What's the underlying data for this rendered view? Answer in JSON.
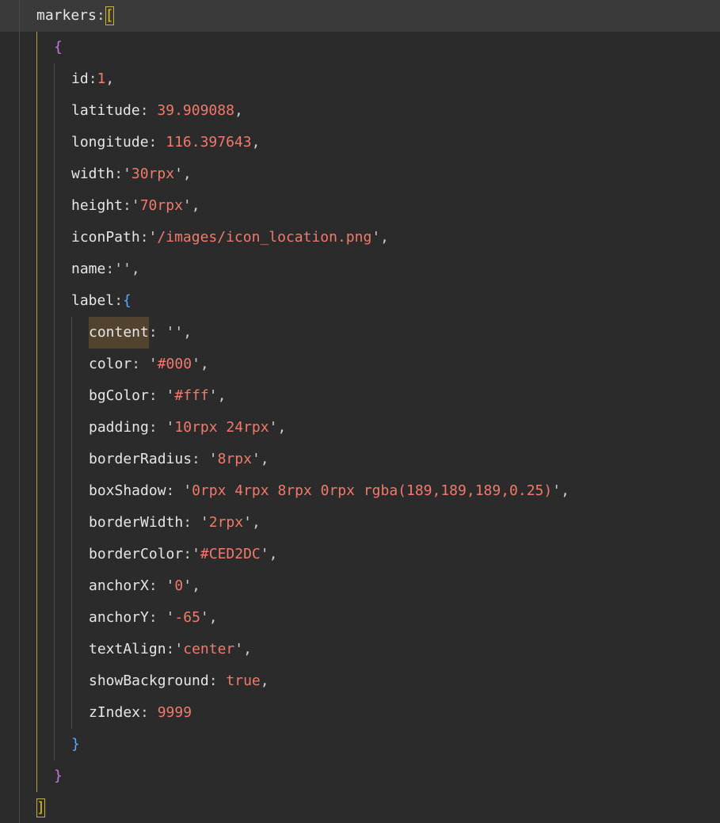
{
  "code": {
    "lines": [
      {
        "indent": 0,
        "tokens": [
          {
            "t": "k",
            "v": "markers"
          },
          {
            "t": "p",
            "v": ":"
          },
          {
            "t": "br0",
            "v": "["
          }
        ]
      },
      {
        "indent": 1,
        "tokens": [
          {
            "t": "br1",
            "v": "{"
          }
        ]
      },
      {
        "indent": 2,
        "tokens": [
          {
            "t": "k",
            "v": "id"
          },
          {
            "t": "p",
            "v": ":"
          },
          {
            "t": "num",
            "v": "1"
          },
          {
            "t": "p",
            "v": ","
          }
        ]
      },
      {
        "indent": 2,
        "tokens": [
          {
            "t": "k",
            "v": "latitude"
          },
          {
            "t": "p",
            "v": ": "
          },
          {
            "t": "num",
            "v": "39.909088"
          },
          {
            "t": "p",
            "v": ","
          }
        ]
      },
      {
        "indent": 2,
        "tokens": [
          {
            "t": "k",
            "v": "longitude"
          },
          {
            "t": "p",
            "v": ": "
          },
          {
            "t": "num",
            "v": "116.397643"
          },
          {
            "t": "p",
            "v": ","
          }
        ]
      },
      {
        "indent": 2,
        "tokens": [
          {
            "t": "k",
            "v": "width"
          },
          {
            "t": "p",
            "v": ":"
          },
          {
            "t": "q",
            "v": "'"
          },
          {
            "t": "str",
            "v": "30rpx"
          },
          {
            "t": "q",
            "v": "'"
          },
          {
            "t": "p",
            "v": ","
          }
        ]
      },
      {
        "indent": 2,
        "tokens": [
          {
            "t": "k",
            "v": "height"
          },
          {
            "t": "p",
            "v": ":"
          },
          {
            "t": "q",
            "v": "'"
          },
          {
            "t": "str",
            "v": "70rpx"
          },
          {
            "t": "q",
            "v": "'"
          },
          {
            "t": "p",
            "v": ","
          }
        ]
      },
      {
        "indent": 2,
        "tokens": [
          {
            "t": "k",
            "v": "iconPath"
          },
          {
            "t": "p",
            "v": ":"
          },
          {
            "t": "q",
            "v": "'"
          },
          {
            "t": "str",
            "v": "/images/icon_location.png"
          },
          {
            "t": "q",
            "v": "'"
          },
          {
            "t": "p",
            "v": ","
          }
        ]
      },
      {
        "indent": 2,
        "tokens": [
          {
            "t": "k",
            "v": "name"
          },
          {
            "t": "p",
            "v": ":"
          },
          {
            "t": "q",
            "v": "''"
          },
          {
            "t": "p",
            "v": ","
          }
        ]
      },
      {
        "indent": 2,
        "tokens": [
          {
            "t": "k",
            "v": "label"
          },
          {
            "t": "p",
            "v": ":"
          },
          {
            "t": "br2",
            "v": "{"
          }
        ]
      },
      {
        "indent": 3,
        "tokens": [
          {
            "t": "hl",
            "v": "content"
          },
          {
            "t": "p",
            "v": ": "
          },
          {
            "t": "q",
            "v": "''"
          },
          {
            "t": "p",
            "v": ","
          }
        ]
      },
      {
        "indent": 3,
        "tokens": [
          {
            "t": "k",
            "v": "color"
          },
          {
            "t": "p",
            "v": ": "
          },
          {
            "t": "q",
            "v": "'"
          },
          {
            "t": "str",
            "v": "#000"
          },
          {
            "t": "q",
            "v": "'"
          },
          {
            "t": "p",
            "v": ","
          }
        ]
      },
      {
        "indent": 3,
        "tokens": [
          {
            "t": "k",
            "v": "bgColor"
          },
          {
            "t": "p",
            "v": ": "
          },
          {
            "t": "q",
            "v": "'"
          },
          {
            "t": "str",
            "v": "#fff"
          },
          {
            "t": "q",
            "v": "'"
          },
          {
            "t": "p",
            "v": ","
          }
        ]
      },
      {
        "indent": 3,
        "tokens": [
          {
            "t": "k",
            "v": "padding"
          },
          {
            "t": "p",
            "v": ": "
          },
          {
            "t": "q",
            "v": "'"
          },
          {
            "t": "str",
            "v": "10rpx 24rpx"
          },
          {
            "t": "q",
            "v": "'"
          },
          {
            "t": "p",
            "v": ","
          }
        ]
      },
      {
        "indent": 3,
        "tokens": [
          {
            "t": "k",
            "v": "borderRadius"
          },
          {
            "t": "p",
            "v": ": "
          },
          {
            "t": "q",
            "v": "'"
          },
          {
            "t": "str",
            "v": "8rpx"
          },
          {
            "t": "q",
            "v": "'"
          },
          {
            "t": "p",
            "v": ","
          }
        ]
      },
      {
        "indent": 3,
        "tokens": [
          {
            "t": "k",
            "v": "boxShadow"
          },
          {
            "t": "p",
            "v": ": "
          },
          {
            "t": "q",
            "v": "'"
          },
          {
            "t": "str",
            "v": "0rpx 4rpx 8rpx 0rpx rgba(189,189,189,0.25)"
          },
          {
            "t": "q",
            "v": "'"
          },
          {
            "t": "p",
            "v": ","
          }
        ]
      },
      {
        "indent": 3,
        "tokens": [
          {
            "t": "k",
            "v": "borderWidth"
          },
          {
            "t": "p",
            "v": ": "
          },
          {
            "t": "q",
            "v": "'"
          },
          {
            "t": "str",
            "v": "2rpx"
          },
          {
            "t": "q",
            "v": "'"
          },
          {
            "t": "p",
            "v": ","
          }
        ]
      },
      {
        "indent": 3,
        "tokens": [
          {
            "t": "k",
            "v": "borderColor"
          },
          {
            "t": "p",
            "v": ":"
          },
          {
            "t": "q",
            "v": "'"
          },
          {
            "t": "str",
            "v": "#CED2DC"
          },
          {
            "t": "q",
            "v": "'"
          },
          {
            "t": "p",
            "v": ","
          }
        ]
      },
      {
        "indent": 3,
        "tokens": [
          {
            "t": "k",
            "v": "anchorX"
          },
          {
            "t": "p",
            "v": ": "
          },
          {
            "t": "q",
            "v": "'"
          },
          {
            "t": "str",
            "v": "0"
          },
          {
            "t": "q",
            "v": "'"
          },
          {
            "t": "p",
            "v": ","
          }
        ]
      },
      {
        "indent": 3,
        "tokens": [
          {
            "t": "k",
            "v": "anchorY"
          },
          {
            "t": "p",
            "v": ": "
          },
          {
            "t": "q",
            "v": "'"
          },
          {
            "t": "str",
            "v": "-65"
          },
          {
            "t": "q",
            "v": "'"
          },
          {
            "t": "p",
            "v": ","
          }
        ]
      },
      {
        "indent": 3,
        "tokens": [
          {
            "t": "k",
            "v": "textAlign"
          },
          {
            "t": "p",
            "v": ":"
          },
          {
            "t": "q",
            "v": "'"
          },
          {
            "t": "str",
            "v": "center"
          },
          {
            "t": "q",
            "v": "'"
          },
          {
            "t": "p",
            "v": ","
          }
        ]
      },
      {
        "indent": 3,
        "tokens": [
          {
            "t": "k",
            "v": "showBackground"
          },
          {
            "t": "p",
            "v": ": "
          },
          {
            "t": "bool",
            "v": "true"
          },
          {
            "t": "p",
            "v": ","
          }
        ]
      },
      {
        "indent": 3,
        "tokens": [
          {
            "t": "k",
            "v": "zIndex"
          },
          {
            "t": "p",
            "v": ": "
          },
          {
            "t": "num",
            "v": "9999"
          }
        ]
      },
      {
        "indent": 2,
        "tokens": [
          {
            "t": "br2",
            "v": "}"
          }
        ]
      },
      {
        "indent": 1,
        "tokens": [
          {
            "t": "br1",
            "v": "}"
          }
        ]
      },
      {
        "indent": 0,
        "tokens": [
          {
            "t": "br0",
            "v": "]"
          }
        ]
      }
    ]
  },
  "colors": {
    "background": "#2b2b2b",
    "current_line": "#3a3a3a",
    "string": "#f07a6c",
    "number": "#f07a6c",
    "bracket_level1": "#c678dd",
    "bracket_level2": "#56a8ff",
    "bracket_level0": "#e5c000",
    "word_highlight": "#52432e"
  }
}
